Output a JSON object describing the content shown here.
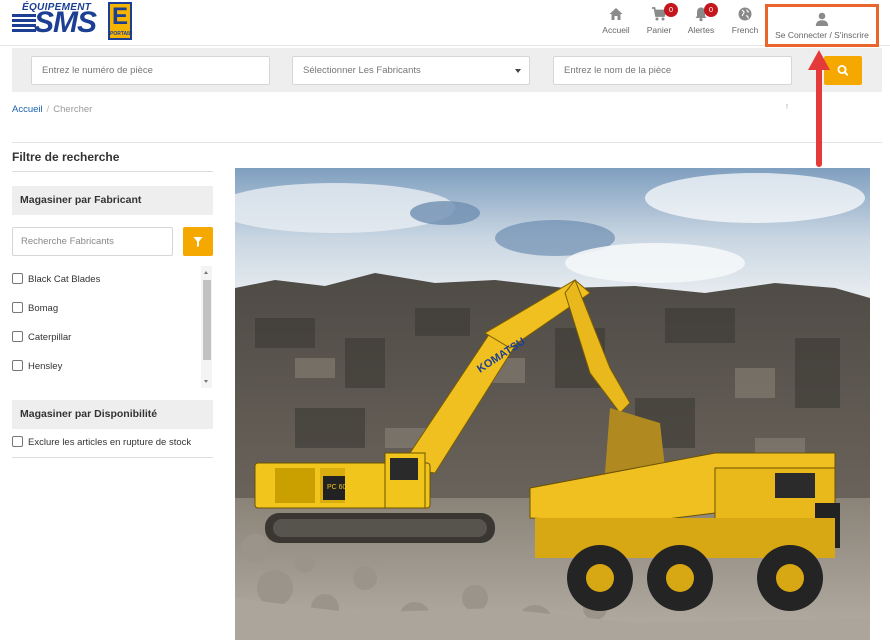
{
  "header": {
    "logo": {
      "top_text": "ÉQUIPEMENT",
      "brand": "SMS",
      "badge_letter": "E",
      "badge_text": "PORTAIL"
    },
    "nav": {
      "home": {
        "label": "Accueil",
        "icon": "home-icon"
      },
      "cart": {
        "label": "Panier",
        "icon": "cart-icon",
        "badge": "0"
      },
      "alerts": {
        "label": "Alertes",
        "icon": "bell-icon",
        "badge": "0"
      },
      "language": {
        "label": "French",
        "icon": "globe-icon"
      },
      "login": {
        "label": "Se Connecter / S'inscrire",
        "icon": "user-icon"
      }
    }
  },
  "search": {
    "part_number_placeholder": "Entrez le numéro de pièce",
    "manufacturer_select": "Sélectionner Les Fabricants",
    "part_name_placeholder": "Entrez le nom de la pièce",
    "button_icon": "search-icon"
  },
  "breadcrumb": {
    "home": "Accueil",
    "separator": "/",
    "current": "Chercher",
    "extra": "!"
  },
  "sidebar": {
    "title": "Filtre de recherche",
    "manufacturer_section": {
      "title": "Magasiner par Fabricant",
      "search_placeholder": "Recherche Fabricants",
      "filter_icon": "funnel-icon",
      "items": [
        "Black Cat Blades",
        "Bomag",
        "Caterpillar",
        "Hensley"
      ]
    },
    "availability_section": {
      "title": "Magasiner par Disponibilité",
      "items": [
        "Exclure les articles en rupture de stock"
      ]
    }
  },
  "hero": {
    "image": "excavator-and-haul-truck-photo",
    "excavator_label": "KOMATSU",
    "excavator_model": "PC 600"
  },
  "colors": {
    "brand_blue": "#1c3f94",
    "accent_orange": "#f5a800",
    "badge_red": "#c5161d",
    "link_blue": "#1c62b0",
    "annotation_orange": "#e8652c",
    "annotation_arrow": "#e53a3a"
  }
}
